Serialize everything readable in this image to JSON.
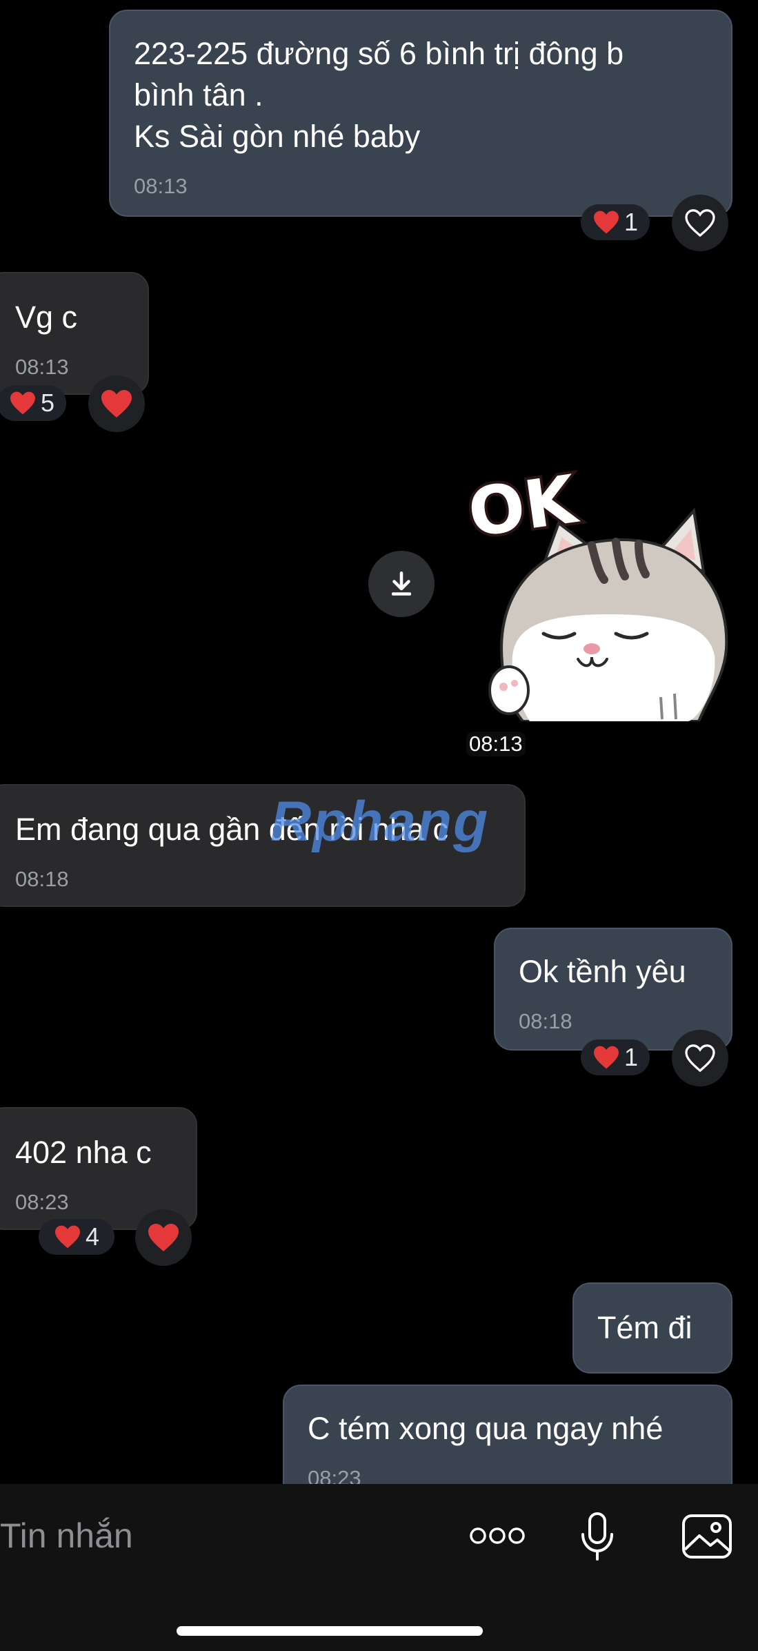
{
  "messages": [
    {
      "id": "m1",
      "direction": "sent",
      "text": "223-225 đường số 6 bình trị đông b\nbình tân .\nKs Sài gòn nhé baby",
      "time": "08:13",
      "reaction_count": "1"
    },
    {
      "id": "m2",
      "direction": "received",
      "text": "Vg c",
      "time": "08:13",
      "reaction_count": "5"
    },
    {
      "id": "m3",
      "direction": "received",
      "type": "sticker",
      "sticker_text": "OK",
      "time": "08:13"
    },
    {
      "id": "m4",
      "direction": "received",
      "text": "Em đang qua gần đến rồi nha c",
      "time": "08:18"
    },
    {
      "id": "m5",
      "direction": "sent",
      "text": "Ok tềnh yêu",
      "time": "08:18",
      "reaction_count": "1"
    },
    {
      "id": "m6",
      "direction": "received",
      "text": "402 nha c",
      "time": "08:23",
      "reaction_count": "4"
    },
    {
      "id": "m7",
      "direction": "sent",
      "text": "Tém đi"
    },
    {
      "id": "m8",
      "direction": "sent",
      "text": "C tém xong qua ngay nhé",
      "time": "08:23"
    }
  ],
  "watermark": "Rphang",
  "composer": {
    "placeholder": "Tin nhắn",
    "icons": [
      "more-icon",
      "mic-icon",
      "image-icon"
    ]
  },
  "colors": {
    "sent_bubble": "#3a4350",
    "received_bubble": "#2a2a2c",
    "heart": "#e5383b"
  }
}
